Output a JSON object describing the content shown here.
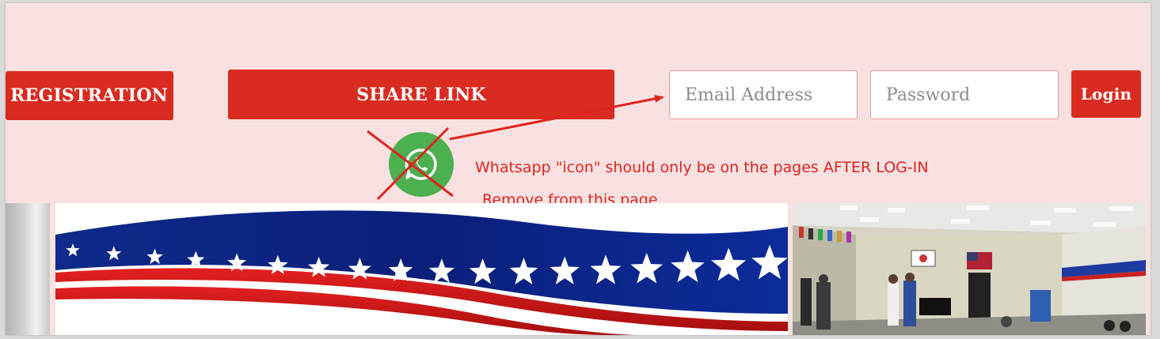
{
  "header": {
    "registration_label": "REGISTRATION",
    "share_link_label": "SHARE LINK",
    "login_label": "Login"
  },
  "login_form": {
    "email_placeholder": "Email Address",
    "password_placeholder": "Password"
  },
  "annotation": {
    "line1": "Whatsapp \"icon\" should only be on the pages AFTER LOG-IN",
    "line2": "Remove from this page",
    "color": "#e0231e"
  },
  "colors": {
    "panel_bg": "#f9e1e1",
    "button_red": "#d92b20",
    "whatsapp_green": "#4caf50"
  },
  "icons": {
    "whatsapp": "whatsapp-icon"
  }
}
